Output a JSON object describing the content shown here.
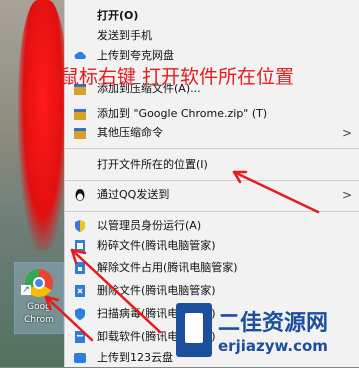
{
  "desktop": {
    "icon_label_line1": "Goog",
    "icon_label_line2": "Chrom"
  },
  "menu": {
    "items": [
      {
        "label": "打开(O)",
        "icon": "none",
        "bold": true
      },
      {
        "label": "发送到手机",
        "icon": "none"
      },
      {
        "label": "上传到夸克网盘",
        "icon": "cloud-icon"
      },
      {
        "label": "添加到压缩文件(A)...",
        "icon": "archive-icon"
      },
      {
        "label": "添加到 \"Google Chrome.zip\" (T)",
        "icon": "archive-icon"
      },
      {
        "label": "其他压缩命令",
        "icon": "archive-icon",
        "submenu": true
      },
      {
        "label": "打开文件所在的位置(I)",
        "icon": "none"
      },
      {
        "label": "通过QQ发送到",
        "icon": "qq-icon",
        "submenu": true
      },
      {
        "label": "以管理员身份运行(A)",
        "icon": "shield-icon"
      },
      {
        "label": "粉碎文件(腾讯电脑管家)",
        "icon": "shred-icon"
      },
      {
        "label": "解除文件占用(腾讯电脑管家)",
        "icon": "unlock-icon"
      },
      {
        "label": "删除文件(腾讯电脑管家)",
        "icon": "delete-icon"
      },
      {
        "label": "扫描病毒(腾讯电脑管家)",
        "icon": "scan-icon"
      },
      {
        "label": "卸载软件(腾讯电脑管家)",
        "icon": "uninstall-icon"
      },
      {
        "label": "上传到123云盘",
        "icon": "cloud123-icon"
      }
    ]
  },
  "annotation": "鼠标右键 打开软件所在位置",
  "watermark": {
    "title": "二佳资源网",
    "domain": "erjiazyw.com"
  },
  "colors": {
    "annotation_red": "#e81b1b",
    "watermark_blue": "#1b4f9e",
    "menu_bg": "#f2f2f2"
  }
}
